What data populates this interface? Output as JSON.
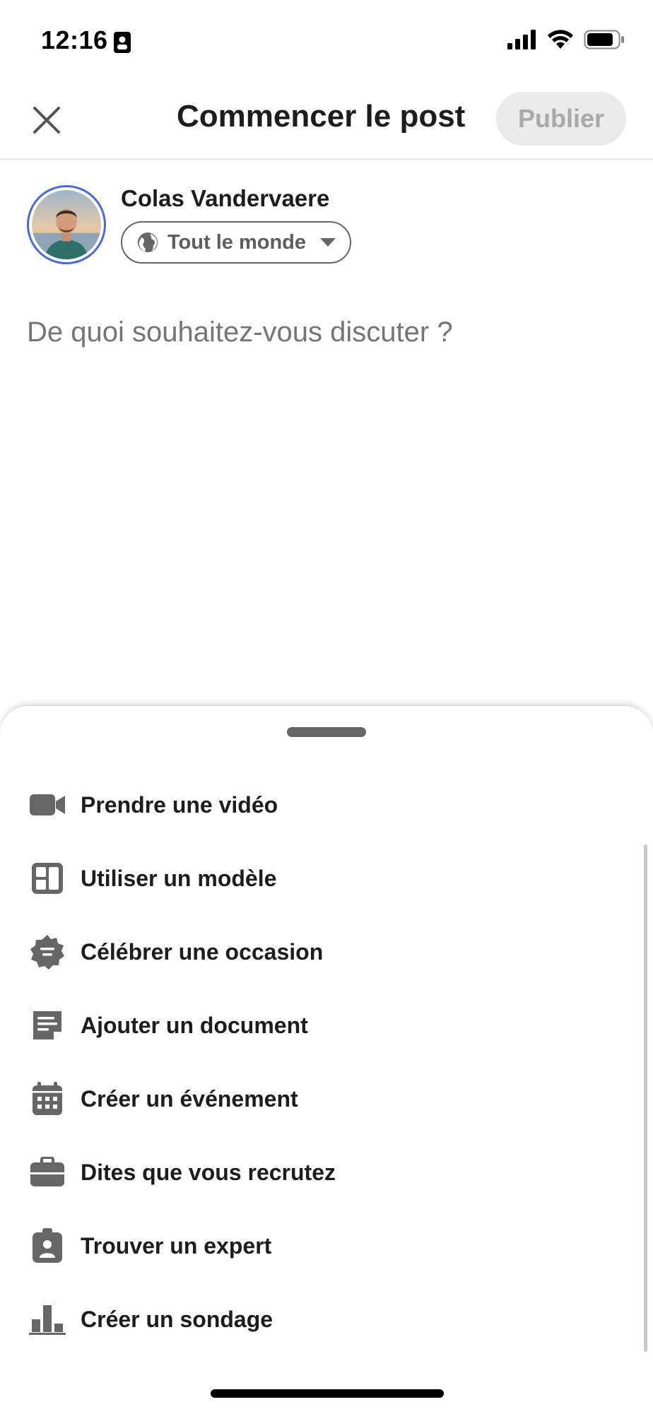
{
  "status_bar": {
    "time": "12:16",
    "icons": [
      "id-card-icon",
      "cellular-signal-icon",
      "wifi-icon",
      "battery-icon"
    ]
  },
  "header": {
    "close_icon": "close-icon",
    "title": "Commencer le post",
    "publish_label": "Publier"
  },
  "author": {
    "name": "Colas Vandervaere",
    "visibility": "Tout le monde",
    "visibility_icon": "globe-icon",
    "caret_icon": "chevron-down-icon"
  },
  "composer": {
    "placeholder": "De quoi souhaitez-vous discuter ?"
  },
  "sheet": {
    "items": [
      {
        "label": "Prendre une vidéo",
        "icon": "video-camera-icon"
      },
      {
        "label": "Utiliser un modèle",
        "icon": "template-icon"
      },
      {
        "label": "Célébrer une occasion",
        "icon": "badge-celebration-icon"
      },
      {
        "label": "Ajouter un document",
        "icon": "document-icon"
      },
      {
        "label": "Créer un événement",
        "icon": "calendar-icon"
      },
      {
        "label": "Dites que vous recrutez",
        "icon": "briefcase-icon"
      },
      {
        "label": "Trouver un expert",
        "icon": "expert-badge-icon"
      },
      {
        "label": "Créer un sondage",
        "icon": "poll-chart-icon"
      }
    ]
  },
  "colors": {
    "avatar_ring": "#4a6ad8",
    "publish_bg": "#ebebeb",
    "publish_text": "#a9a9a9",
    "icon_gray": "#666666",
    "text_dark": "#1d1d1d"
  }
}
